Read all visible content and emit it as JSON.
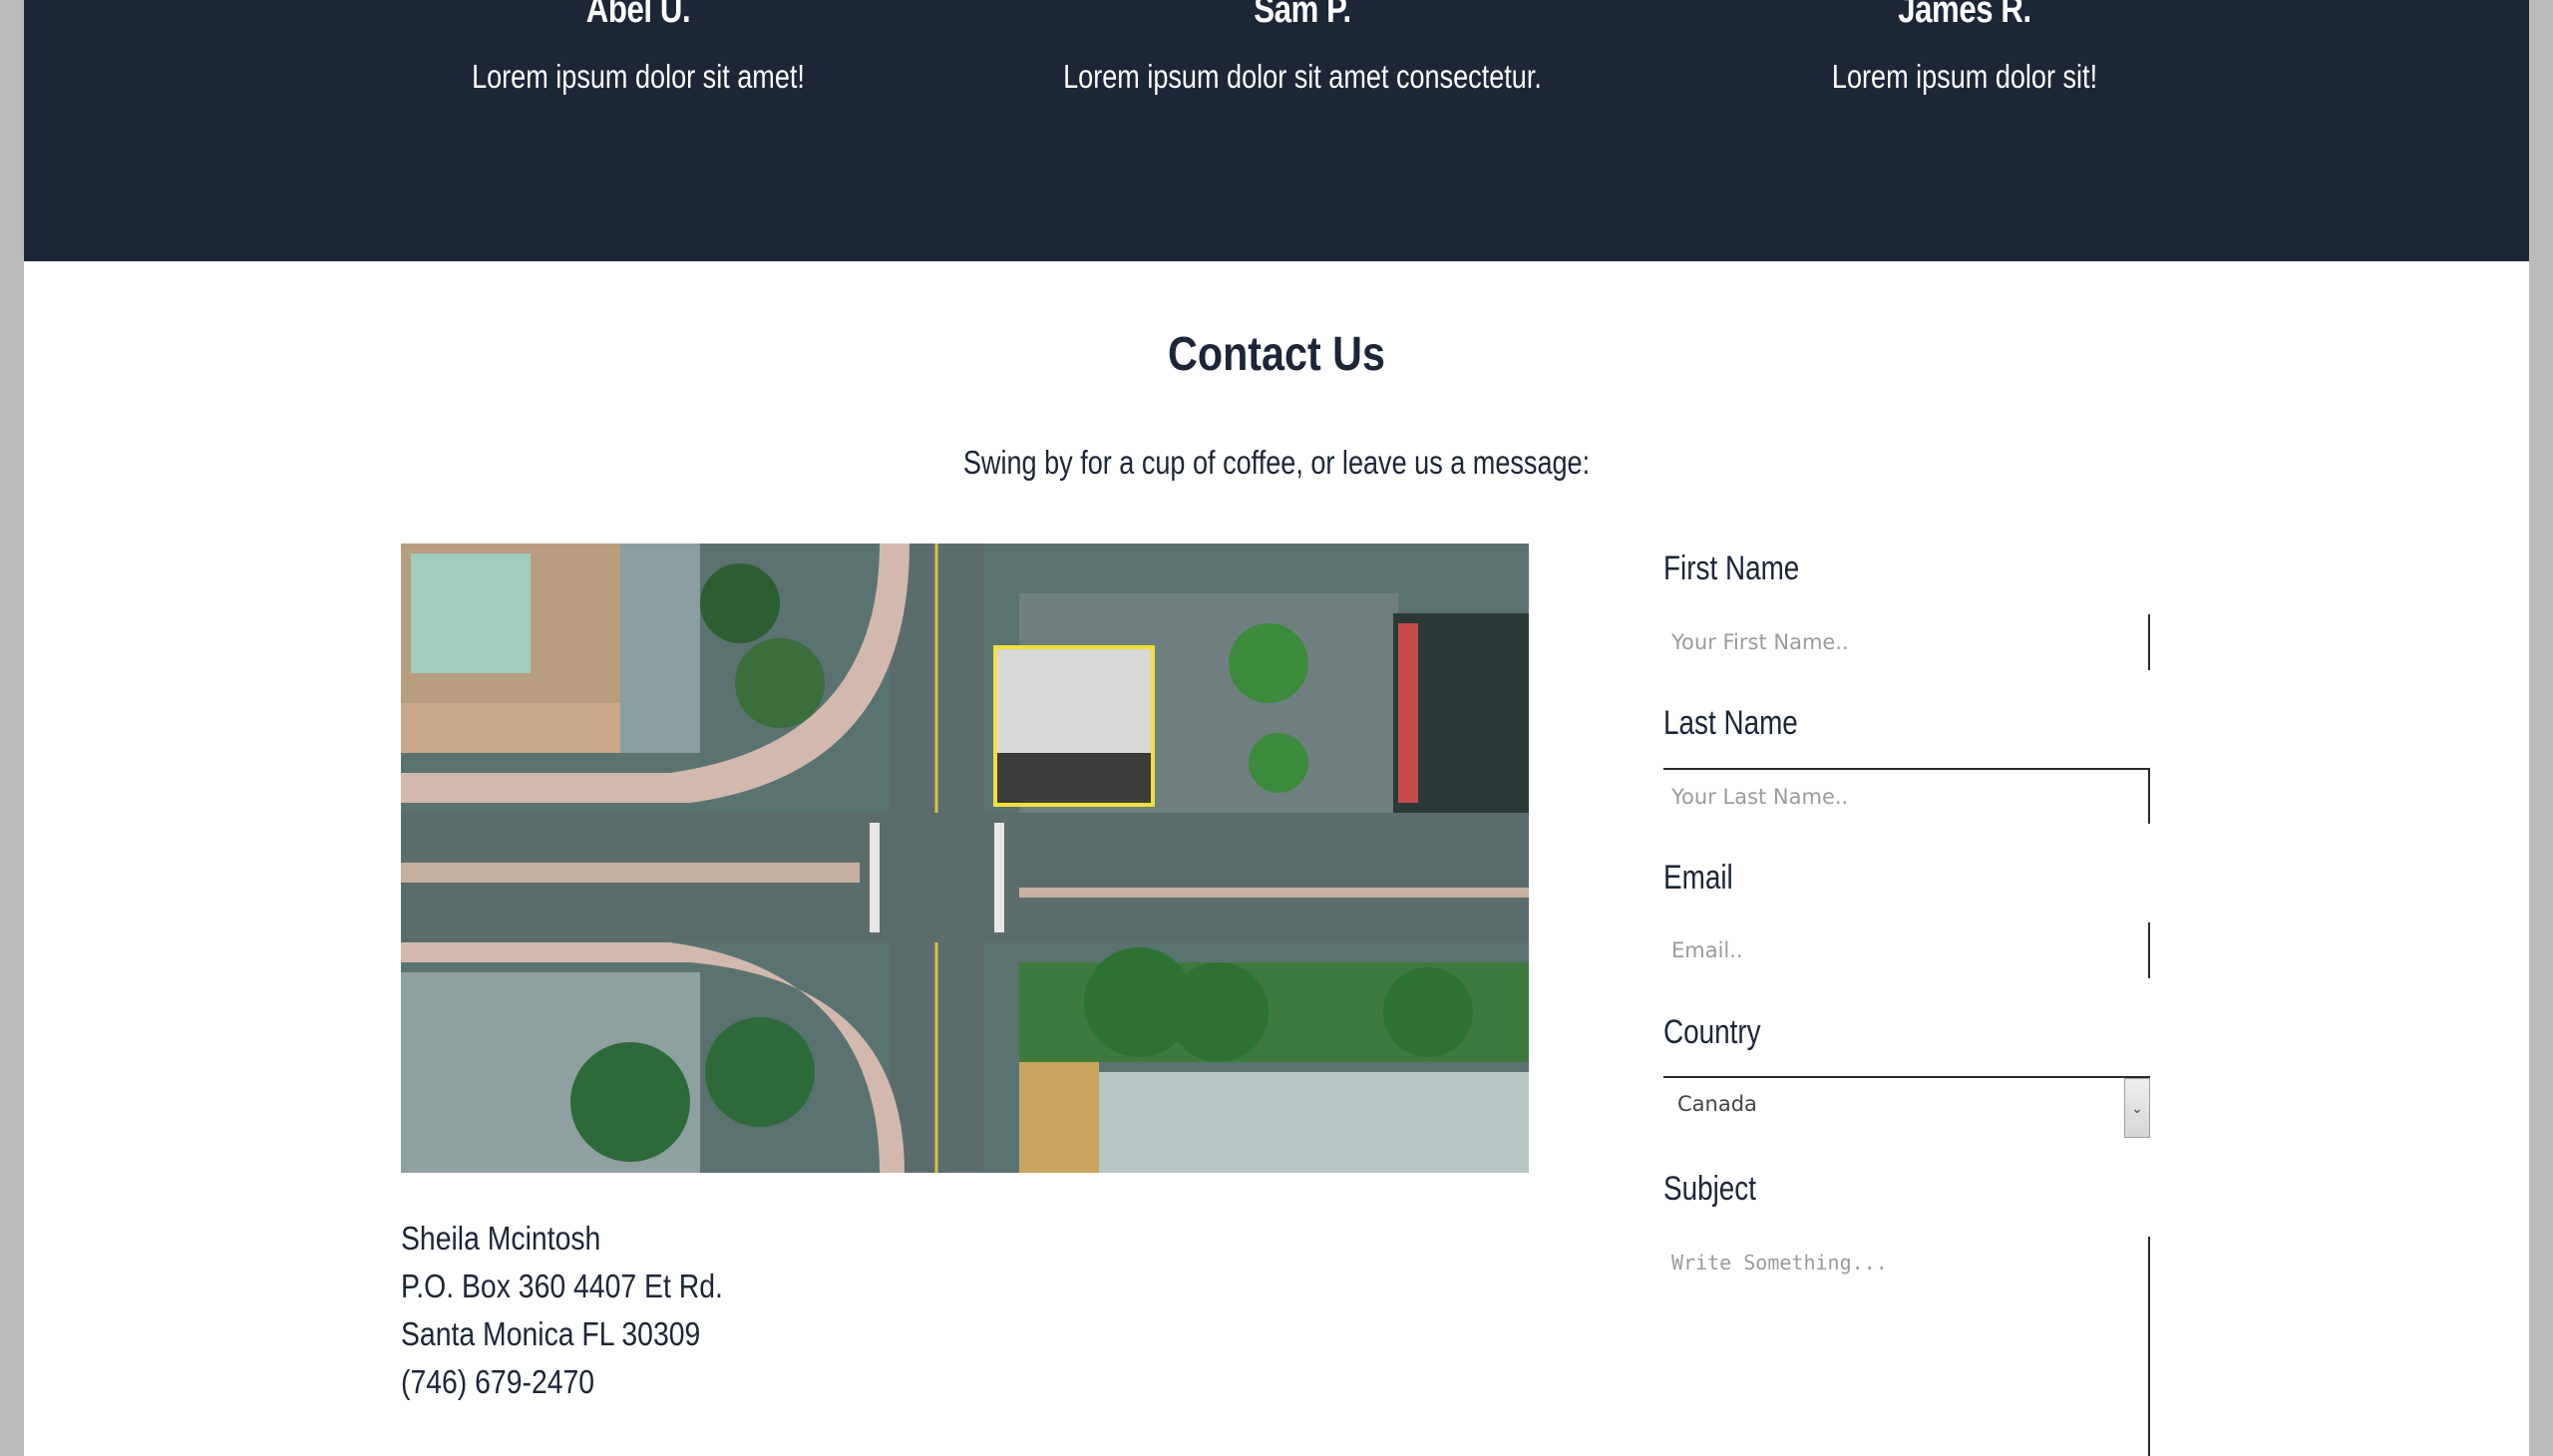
{
  "testimonials": [
    {
      "name": "Abel U.",
      "quote": "Lorem ipsum dolor sit amet!"
    },
    {
      "name": "Sam P.",
      "quote": "Lorem ipsum dolor sit amet consectetur."
    },
    {
      "name": "James R.",
      "quote": "Lorem ipsum dolor sit!"
    }
  ],
  "contact": {
    "title": "Contact Us",
    "subtitle": "Swing by for a cup of coffee, or leave us a message:"
  },
  "address": {
    "name": "Sheila Mcintosh",
    "line1": "P.O. Box 360 4407 Et Rd.",
    "line2": "Santa Monica FL 30309",
    "phone": "(746) 679-2470"
  },
  "form": {
    "first_name_label": "First Name",
    "first_name_placeholder": "Your First Name..",
    "last_name_label": "Last Name",
    "last_name_placeholder": "Your Last Name..",
    "email_label": "Email",
    "email_placeholder": "Email..",
    "country_label": "Country",
    "country_value": "Canada",
    "subject_label": "Subject",
    "subject_placeholder": "Write Something..."
  },
  "colors": {
    "dark_band": "#1c2637",
    "text": "#1c2637",
    "highlight": "#f2e13a"
  },
  "icons": {
    "select_arrow": "chevron-down-icon"
  }
}
